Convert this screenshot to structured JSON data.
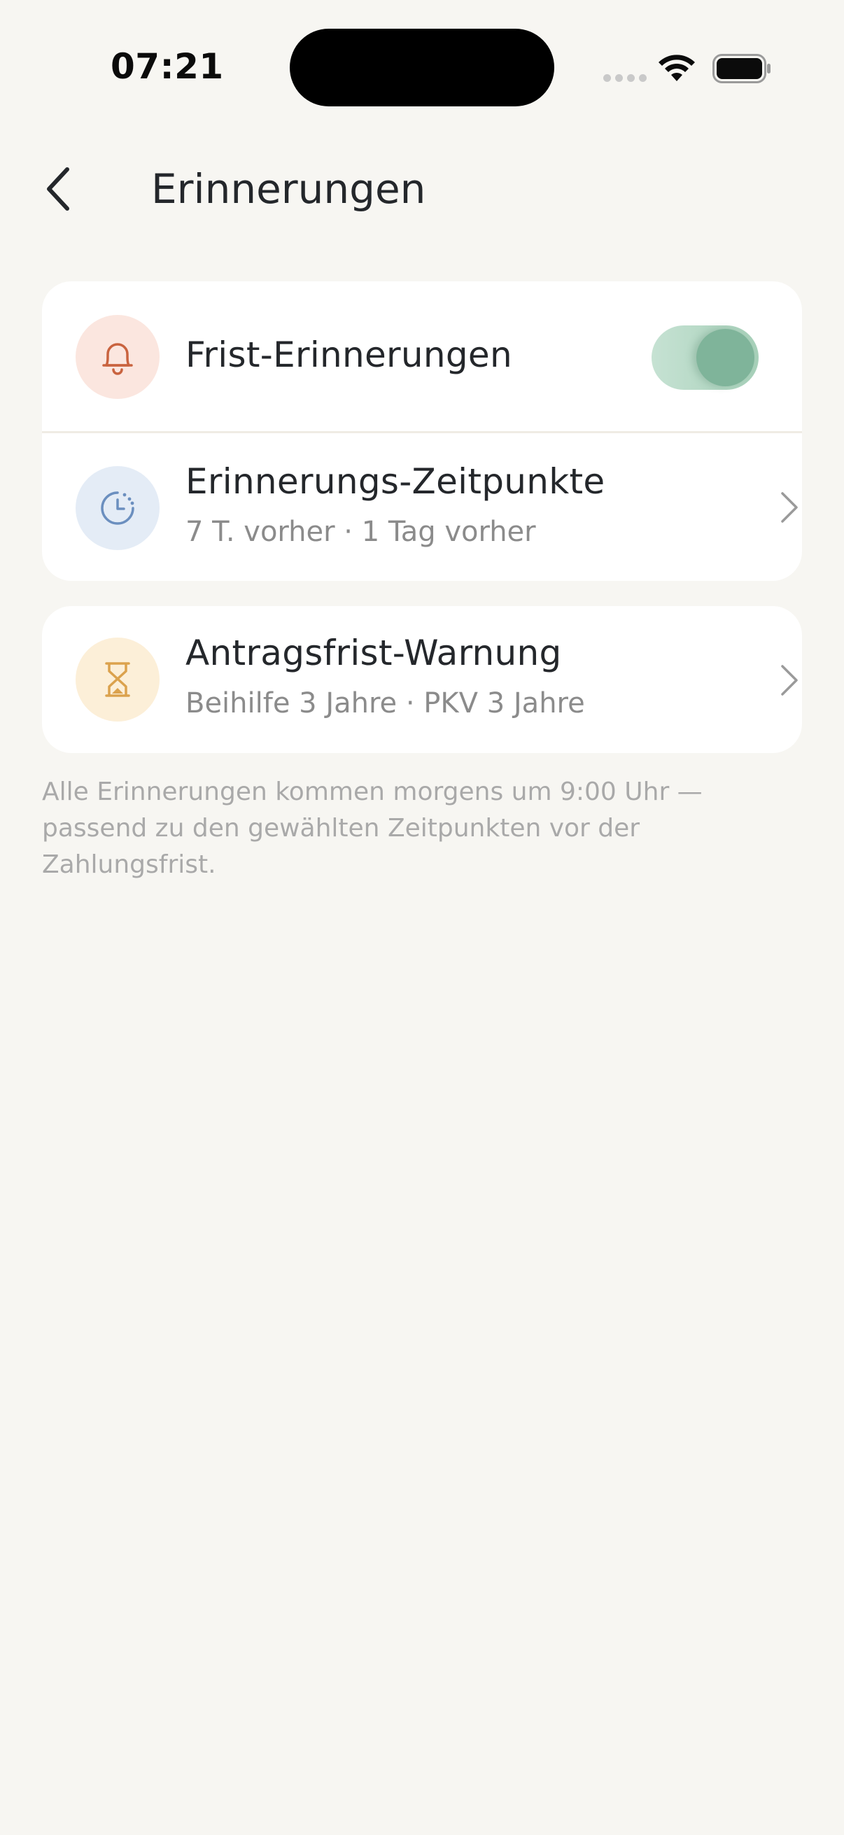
{
  "status_bar": {
    "time": "07:21"
  },
  "header": {
    "title": "Erinnerungen"
  },
  "settings": {
    "deadline_reminders": {
      "title": "Frist-Erinnerungen",
      "enabled": true,
      "icon": "bell-icon",
      "icon_bg": "#fbe6df",
      "icon_color": "#c9633f"
    },
    "reminder_times": {
      "title": "Erinnerungs-Zeitpunkte",
      "subtitle": "7 T. vorher · 1 Tag vorher",
      "icon": "clock-icon",
      "icon_bg": "#e4ecf6",
      "icon_color": "#6b8fbf"
    },
    "application_deadline_warning": {
      "title": "Antragsfrist-Warnung",
      "subtitle": "Beihilfe 3 Jahre · PKV 3 Jahre",
      "icon": "hourglass-icon",
      "icon_bg": "#fcefd8",
      "icon_color": "#dba24d"
    }
  },
  "footnote": "Alle Erinnerungen kommen morgens um 9:00 Uhr — passend zu den gewählten Zeitpunkten vor der Zahlungsfrist.",
  "colors": {
    "background": "#f7f6f2",
    "toggle_on": "#7fb49a"
  }
}
